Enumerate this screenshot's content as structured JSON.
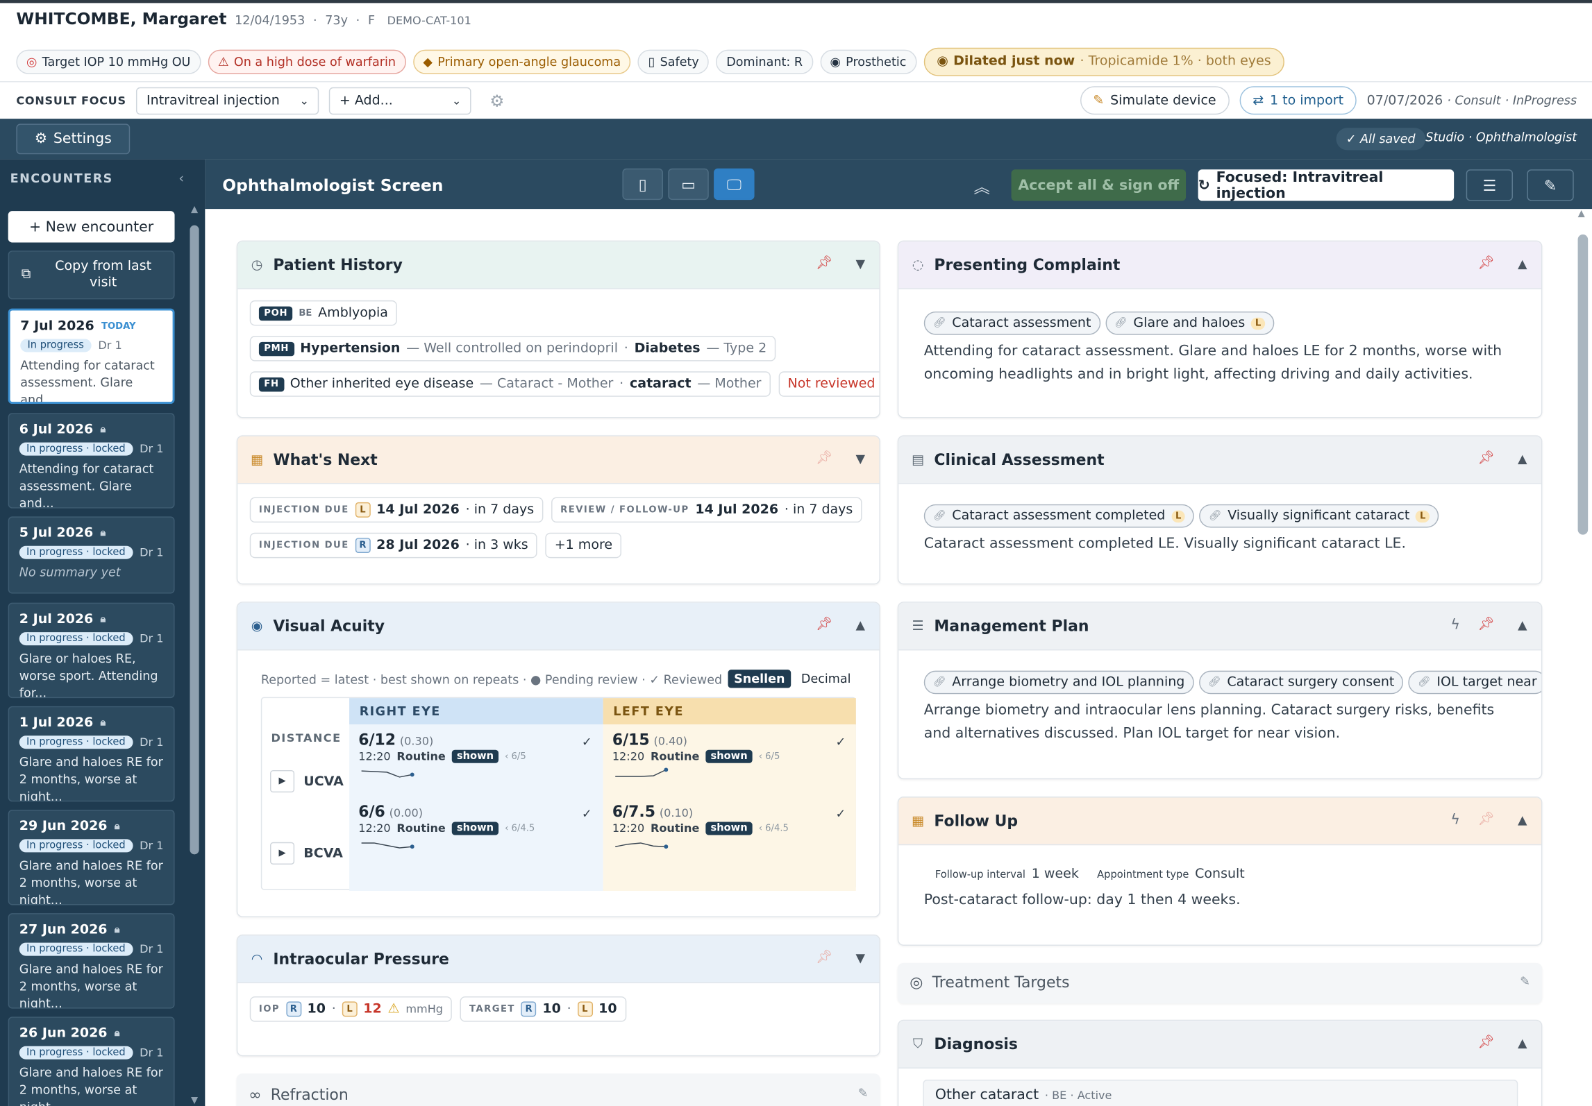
{
  "patient": {
    "name": "WHITCOMBE, Margaret",
    "dob": "12/04/1953",
    "age": "73y",
    "sex": "F",
    "id": "DEMO-CAT-101"
  },
  "chips": {
    "target": "Target IOP 10 mmHg OU",
    "warfarin": "On a high dose of warfarin",
    "diagnosis": "Primary open-angle glaucoma",
    "safety": "Safety",
    "dominant": "Dominant: R",
    "prosthetic": "Prosthetic",
    "dilated": "Dilated just now",
    "dilated_sub": "· Tropicamide 1% · both eyes"
  },
  "consult": {
    "label": "CONSULT FOCUS",
    "focus": "Intravitreal injection",
    "add": "+ Add...",
    "simulate": "Simulate device",
    "import": "1 to import",
    "date": "07/07/2026",
    "type": "· Consult",
    "status": "· InProgress"
  },
  "bar": {
    "settings": "Settings",
    "saved": "✓ All saved",
    "studio": "Studio · Ophthalmologist"
  },
  "sidebar": {
    "header": "ENCOUNTERS",
    "new": "+ New encounter",
    "copy": "Copy from last visit",
    "encounters": [
      {
        "date": "7 Jul 2026",
        "tag": "TODAY",
        "status": "In progress",
        "dr": "Dr 1",
        "summary": "Attending for cataract assessment. Glare and..."
      },
      {
        "date": "6 Jul 2026",
        "status": "In progress · locked",
        "dr": "Dr 1",
        "summary": "Attending for cataract assessment. Glare and..."
      },
      {
        "date": "5 Jul 2026",
        "status": "In progress · locked",
        "dr": "Dr 1",
        "summary": "No summary yet"
      },
      {
        "date": "2 Jul 2026",
        "status": "In progress · locked",
        "dr": "Dr 1",
        "summary": "Glare or haloes RE, worse sport. Attending for..."
      },
      {
        "date": "1 Jul 2026",
        "status": "In progress · locked",
        "dr": "Dr 1",
        "summary": "Glare and haloes RE for 2 months, worse at night..."
      },
      {
        "date": "29 Jun 2026",
        "status": "In progress · locked",
        "dr": "Dr 1",
        "summary": "Glare and haloes RE for 2 months, worse at night..."
      },
      {
        "date": "27 Jun 2026",
        "status": "In progress · locked",
        "dr": "Dr 1",
        "summary": "Glare and haloes RE for 2 months, worse at night..."
      },
      {
        "date": "26 Jun 2026",
        "status": "In progress · locked",
        "dr": "Dr 1",
        "summary": "Glare and haloes RE for 2 months, worse at night..."
      }
    ]
  },
  "main": {
    "title": "Ophthalmologist Screen",
    "accept": "Accept all & sign off",
    "focused": "Focused: Intravitreal injection"
  },
  "history": {
    "title": "Patient History",
    "poh_key": "POH",
    "poh_eye": "BE",
    "poh": "Amblyopia",
    "pmh_key": "PMH",
    "pmh1": "Hypertension",
    "pmh1_note": "— Well controlled on perindopril",
    "pmh2": "Diabetes",
    "pmh2_note": "— Type 2",
    "fh_key": "FH",
    "fh1": "Other inherited eye disease",
    "fh1_note": "— Cataract - Mother",
    "fh2": "cataract",
    "fh2_note": "— Mother",
    "not_reviewed": "Not reviewed"
  },
  "next": {
    "title": "What's Next",
    "items": [
      {
        "label": "INJECTION DUE",
        "eye": "L",
        "date": "14 Jul 2026",
        "rel": "· in 7 days"
      },
      {
        "label": "REVIEW / FOLLOW-UP",
        "eye": "",
        "date": "14 Jul 2026",
        "rel": "· in 7 days"
      },
      {
        "label": "INJECTION DUE",
        "eye": "R",
        "date": "28 Jul 2026",
        "rel": "· in 3 wks"
      }
    ],
    "more": "+1 more"
  },
  "va": {
    "title": "Visual Acuity",
    "legend": "Reported = latest · best shown on repeats · ● Pending review · ✓ Reviewed",
    "snellen": "Snellen",
    "decimal": "Decimal",
    "right": "RIGHT EYE",
    "left": "LEFT EYE",
    "distance": "DISTANCE",
    "rows": [
      {
        "label": "UCVA",
        "r": {
          "value": "6/12",
          "dec": "(0.30)",
          "time": "12:20",
          "kind": "Routine",
          "shown": "shown",
          "best": "‹ 6/5"
        },
        "l": {
          "value": "6/15",
          "dec": "(0.40)",
          "time": "12:20",
          "kind": "Routine",
          "shown": "shown",
          "best": "‹ 6/5"
        }
      },
      {
        "label": "BCVA",
        "r": {
          "value": "6/6",
          "dec": "(0.00)",
          "time": "12:20",
          "kind": "Routine",
          "shown": "shown",
          "best": "‹ 6/4.5"
        },
        "l": {
          "value": "6/7.5",
          "dec": "(0.10)",
          "time": "12:20",
          "kind": "Routine",
          "shown": "shown",
          "best": "‹ 6/4.5"
        }
      }
    ]
  },
  "iop": {
    "title": "Intraocular Pressure",
    "iop_label": "IOP",
    "r": "10",
    "l": "12",
    "unit": "mmHg",
    "target_label": "TARGET",
    "tr": "10",
    "tl": "10"
  },
  "refraction": {
    "title": "Refraction"
  },
  "complaint": {
    "title": "Presenting Complaint",
    "tags": [
      "Cataract assessment",
      "Glare and haloes"
    ],
    "text": "Attending for cataract assessment. Glare and haloes LE for 2 months, worse with oncoming headlights and in bright light, affecting driving and daily activities."
  },
  "assessment": {
    "title": "Clinical Assessment",
    "tags": [
      "Cataract assessment completed",
      "Visually significant cataract"
    ],
    "text": "Cataract assessment completed LE. Visually significant cataract LE."
  },
  "plan": {
    "title": "Management Plan",
    "tags": [
      "Arrange biometry and IOL planning",
      "Cataract surgery consent",
      "IOL target near"
    ],
    "text": "Arrange biometry and intraocular lens planning. Cataract surgery risks, benefits and alternatives discussed. Plan IOL target for near vision."
  },
  "followup": {
    "title": "Follow Up",
    "interval_label": "Follow-up interval",
    "interval": "1 week",
    "appt_label": "Appointment type",
    "appt": "Consult",
    "text": "Post-cataract follow-up: day 1 then 4 weeks."
  },
  "targets": {
    "title": "Treatment Targets"
  },
  "diagnosis": {
    "title": "Diagnosis",
    "item": "Other cataract",
    "meta": "· BE · Active"
  },
  "icons": {
    "pin": "pin-icon",
    "toggle": "chevron-icon",
    "bolt": "bolt-icon",
    "lock": "lock-icon"
  },
  "colors": {
    "accent": "#2f7fc4",
    "dark": "#2b4a60",
    "pin": "#d23b3b",
    "warning": "#c7362a"
  },
  "sparklines": {
    "ucva_r": [
      0.4,
      0.45,
      0.5,
      0.9,
      0.7
    ],
    "ucva_l": [
      0.85,
      0.85,
      0.85,
      0.8,
      0.3
    ],
    "bcva_r": [
      0.4,
      0.4,
      0.6,
      0.8,
      0.7
    ],
    "bcva_l": [
      0.7,
      0.5,
      0.4,
      0.65,
      0.7
    ]
  }
}
